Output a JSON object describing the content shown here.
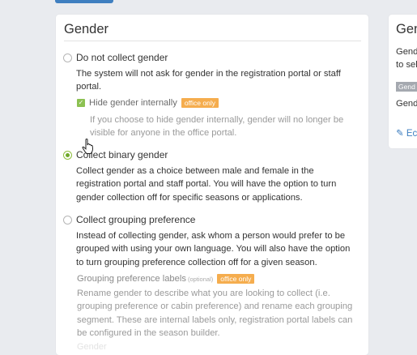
{
  "gender_card": {
    "title": "Gender",
    "options": [
      {
        "label": "Do not collect gender",
        "selected": false,
        "description": "The system will not ask for gender in the registration portal or staff portal.",
        "sub": {
          "checkbox_checked": true,
          "label": "Hide gender internally",
          "badge": "office only",
          "description": "If you choose to hide gender internally, gender will no longer be visible for anyone in the office portal."
        }
      },
      {
        "label": "Collect binary gender",
        "selected": true,
        "description": "Collect gender as a choice between male and female in the registration portal and staff portal. You will have the option to turn gender collection off for specific seasons or applications."
      },
      {
        "label": "Collect grouping preference",
        "selected": false,
        "description": "Instead of collecting gender, ask whom a person would prefer to be grouped with using your own language. You will also have the option to turn grouping preference collection off for a given season.",
        "sub": {
          "label": "Grouping preference labels",
          "optional": "(optional)",
          "badge": "office only",
          "description": "Rename gender to describe what you are looking to collect (i.e. grouping preference or cabin preference) and rename each grouping segment. These are internal labels only, registration portal labels can be configured in the season builder."
        }
      }
    ],
    "cutoff_text": "Gender"
  },
  "right_card": {
    "title": "Gen",
    "line1": "Gend",
    "line2": "to sel",
    "tag": "Gend",
    "line3": "Gend",
    "edit_label": "Ec"
  },
  "colors": {
    "accent": "#3f7fc0",
    "radio_selected": "#6fa82a",
    "checkbox": "#8cc152",
    "badge": "#f5ad4e",
    "tag": "#a5a9b0"
  }
}
